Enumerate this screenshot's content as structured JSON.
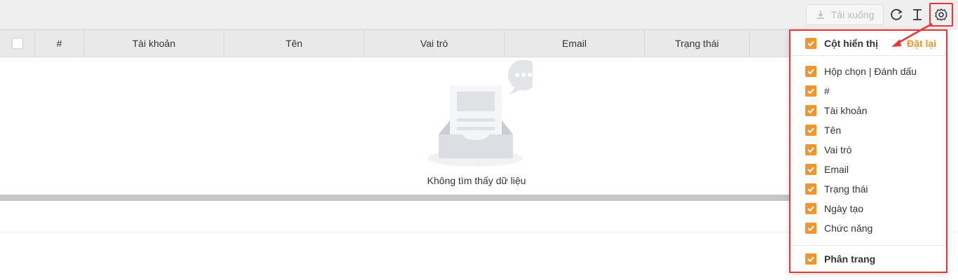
{
  "toolbar": {
    "download_label": "Tải xuống",
    "icons": [
      "download-icon",
      "refresh-icon",
      "text-height-icon",
      "gear-icon"
    ]
  },
  "table": {
    "columns": [
      "#",
      "Tài khoản",
      "Tên",
      "Vai trò",
      "Email",
      "Trạng thái"
    ]
  },
  "empty_state": {
    "message": "Không tìm thấy dữ liệu"
  },
  "column_panel": {
    "header_label": "Cột hiển thị",
    "reset_label": "Đặt lại",
    "options": [
      {
        "label": "Hộp chọn | Đánh dấu",
        "checked": true
      },
      {
        "label": "#",
        "checked": true
      },
      {
        "label": "Tài khoản",
        "checked": true
      },
      {
        "label": "Tên",
        "checked": true
      },
      {
        "label": "Vai trò",
        "checked": true
      },
      {
        "label": "Email",
        "checked": true
      },
      {
        "label": "Trạng thái",
        "checked": true
      },
      {
        "label": "Ngày tạo",
        "checked": true
      },
      {
        "label": "Chức năng",
        "checked": true
      }
    ],
    "pagination_label": "Phân trang"
  },
  "colors": {
    "accent": "#f0962e",
    "highlight": "#e53935",
    "header_bg": "#e9e9e9"
  }
}
